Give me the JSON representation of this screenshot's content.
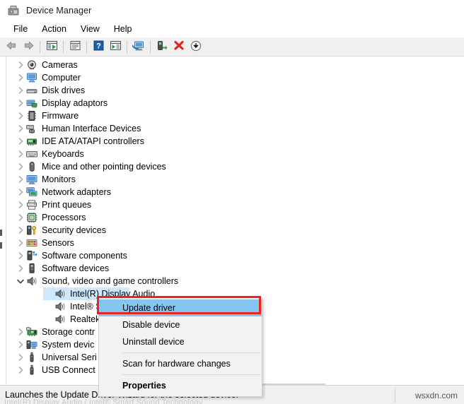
{
  "window": {
    "title": "Device Manager",
    "icon": "device-manager-icon"
  },
  "menubar": {
    "items": [
      {
        "label": "File"
      },
      {
        "label": "Action"
      },
      {
        "label": "View"
      },
      {
        "label": "Help"
      }
    ]
  },
  "toolbar": {
    "buttons": [
      {
        "icon": "back-arrow-icon",
        "name": "back-button"
      },
      {
        "icon": "forward-arrow-icon",
        "name": "forward-button"
      },
      {
        "icon": "separator",
        "name": "toolbar-separator-1"
      },
      {
        "icon": "show-hidden-devices-icon",
        "name": "show-hidden-devices-button"
      },
      {
        "icon": "separator",
        "name": "toolbar-separator-2"
      },
      {
        "icon": "properties-icon",
        "name": "properties-button"
      },
      {
        "icon": "separator",
        "name": "toolbar-separator-3"
      },
      {
        "icon": "help-icon",
        "name": "help-button"
      },
      {
        "icon": "update-driver-icon",
        "name": "update-driver-button"
      },
      {
        "icon": "separator",
        "name": "toolbar-separator-4"
      },
      {
        "icon": "scan-hardware-changes-icon",
        "name": "scan-hardware-changes-button"
      },
      {
        "icon": "separator",
        "name": "toolbar-separator-5"
      },
      {
        "icon": "enable-device-icon",
        "name": "enable-device-button"
      },
      {
        "icon": "uninstall-device-icon",
        "name": "uninstall-device-button"
      },
      {
        "icon": "install-driver-icon",
        "name": "install-driver-button"
      }
    ]
  },
  "tree": {
    "rows": [
      {
        "label": "Cameras",
        "icon": "camera-icon",
        "state": "collapsed",
        "level": 0
      },
      {
        "label": "Computer",
        "icon": "computer-icon",
        "state": "collapsed",
        "level": 0
      },
      {
        "label": "Disk drives",
        "icon": "disk-drive-icon",
        "state": "collapsed",
        "level": 0
      },
      {
        "label": "Display adaptors",
        "icon": "display-adapter-icon",
        "state": "collapsed",
        "level": 0
      },
      {
        "label": "Firmware",
        "icon": "firmware-icon",
        "state": "collapsed",
        "level": 0
      },
      {
        "label": "Human Interface Devices",
        "icon": "hid-icon",
        "state": "collapsed",
        "level": 0
      },
      {
        "label": "IDE ATA/ATAPI controllers",
        "icon": "ide-controller-icon",
        "state": "collapsed",
        "level": 0
      },
      {
        "label": "Keyboards",
        "icon": "keyboard-icon",
        "state": "collapsed",
        "level": 0
      },
      {
        "label": "Mice and other pointing devices",
        "icon": "mouse-icon",
        "state": "collapsed",
        "level": 0
      },
      {
        "label": "Monitors",
        "icon": "monitor-icon",
        "state": "collapsed",
        "level": 0
      },
      {
        "label": "Network adapters",
        "icon": "network-adapter-icon",
        "state": "collapsed",
        "level": 0
      },
      {
        "label": "Print queues",
        "icon": "printer-icon",
        "state": "collapsed",
        "level": 0
      },
      {
        "label": "Processors",
        "icon": "processor-icon",
        "state": "collapsed",
        "level": 0
      },
      {
        "label": "Security devices",
        "icon": "security-device-icon",
        "state": "collapsed",
        "level": 0
      },
      {
        "label": "Sensors",
        "icon": "sensor-icon",
        "state": "collapsed",
        "level": 0
      },
      {
        "label": "Software components",
        "icon": "software-component-icon",
        "state": "collapsed",
        "level": 0
      },
      {
        "label": "Software devices",
        "icon": "software-device-icon",
        "state": "collapsed",
        "level": 0
      },
      {
        "label": "Sound, video and game controllers",
        "icon": "speaker-icon",
        "state": "expanded",
        "level": 0
      },
      {
        "label": "Intel(R) Display Audio",
        "icon": "speaker-icon",
        "state": "leaf",
        "level": 1,
        "selected": true
      },
      {
        "label": "Intel® Sm",
        "icon": "speaker-icon",
        "state": "leaf",
        "level": 1
      },
      {
        "label": "Realtek(R)",
        "icon": "speaker-icon",
        "state": "leaf",
        "level": 1
      },
      {
        "label": "Storage contr",
        "icon": "storage-controller-icon",
        "state": "collapsed",
        "level": 0
      },
      {
        "label": "System devic",
        "icon": "system-device-icon",
        "state": "collapsed",
        "level": 0
      },
      {
        "label": "Universal Seri",
        "icon": "usb-icon",
        "state": "collapsed",
        "level": 0
      },
      {
        "label": "USB Connect",
        "icon": "usb-icon",
        "state": "collapsed",
        "level": 0
      }
    ]
  },
  "context_menu": {
    "items": [
      {
        "label": "Update driver",
        "highlighted": true,
        "bold": false
      },
      {
        "label": "Disable device",
        "highlighted": false,
        "bold": false
      },
      {
        "label": "Uninstall device",
        "highlighted": false,
        "bold": false
      },
      {
        "label": "__separator__"
      },
      {
        "label": "Scan for hardware changes",
        "highlighted": false,
        "bold": false
      },
      {
        "label": "__separator__"
      },
      {
        "label": "Properties",
        "highlighted": false,
        "bold": true
      }
    ]
  },
  "statusbar": {
    "text": "Launches the Update Driver Wizard for the selected device.",
    "watermark": "wsxdn.com",
    "ghost_row": "Intel(R) Display Audio / Intel® Smart Sound Technology"
  },
  "colors": {
    "selection": "#cde8ff",
    "menu_highlight": "#85c6f0",
    "red_outline": "#e8251f",
    "chrome": "#f0f0f0"
  }
}
